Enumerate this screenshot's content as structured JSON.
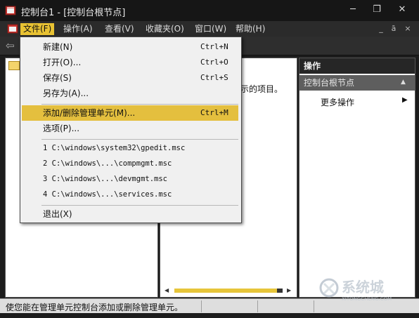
{
  "window": {
    "title": "控制台1 - [控制台根节点]",
    "minimize_glyph": "─",
    "restore_glyph": "❐",
    "close_glyph": "✕"
  },
  "menubar": {
    "items": [
      {
        "label": "文件(F)"
      },
      {
        "label": "操作(A)"
      },
      {
        "label": "查看(V)"
      },
      {
        "label": "收藏夹(O)"
      },
      {
        "label": "窗口(W)"
      },
      {
        "label": "帮助(H)"
      }
    ],
    "mdi_minimize": "_",
    "mdi_restore": "ā",
    "mdi_close": "×"
  },
  "file_menu": {
    "items": [
      {
        "label": "新建(N)",
        "shortcut": "Ctrl+N"
      },
      {
        "label": "打开(O)...",
        "shortcut": "Ctrl+O"
      },
      {
        "label": "保存(S)",
        "shortcut": "Ctrl+S"
      },
      {
        "label": "另存为(A)..."
      },
      {
        "label": "添加/删除管理单元(M)...",
        "shortcut": "Ctrl+M"
      },
      {
        "label": "选项(P)..."
      }
    ],
    "recent": [
      "1 C:\\windows\\system32\\gpedit.msc",
      "2 C:\\windows\\...\\compmgmt.msc",
      "3 C:\\windows\\...\\devmgmt.msc",
      "4 C:\\windows\\...\\services.msc"
    ],
    "exit_label": "退出(X)"
  },
  "content": {
    "text": "示的项目。"
  },
  "actions_pane": {
    "header": "操作",
    "section": "控制台根节点",
    "more_actions": "更多操作"
  },
  "statusbar": {
    "text": "使您能在管理单元控制台添加或删除管理单元。"
  },
  "watermark": {
    "text": "系统城",
    "subtext": "XITONGCHENG.COM"
  },
  "colors": {
    "accent": "#e4bf3e",
    "titlebar": "#161616",
    "menubar": "#2b2b2b"
  }
}
